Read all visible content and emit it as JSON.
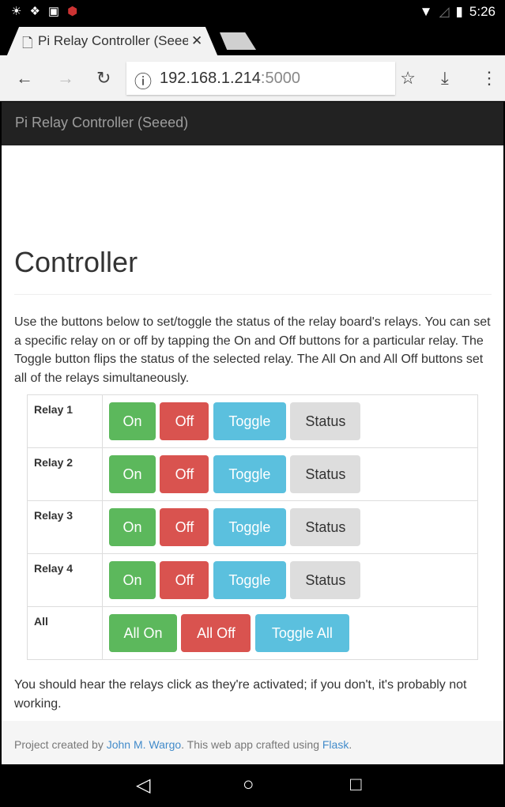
{
  "status_bar": {
    "time": "5:26"
  },
  "browser": {
    "tab_title": "Pi Relay Controller (Seeed)",
    "url_host": "192.168.1.214",
    "url_port": ":5000"
  },
  "navbar": {
    "brand": "Pi Relay Controller (Seeed)"
  },
  "main": {
    "heading": "Controller",
    "description": "Use the buttons below to set/toggle the status of the relay board's relays. You can set a specific relay on or off by tapping the On and Off buttons for a particular relay. The Toggle button flips the status of the selected relay. The All On and All Off buttons set all of the relays simultaneously.",
    "relays": [
      {
        "label": "Relay 1"
      },
      {
        "label": "Relay 2"
      },
      {
        "label": "Relay 3"
      },
      {
        "label": "Relay 4"
      }
    ],
    "buttons": {
      "on": "On",
      "off": "Off",
      "toggle": "Toggle",
      "status": "Status"
    },
    "all": {
      "label": "All",
      "on": "All On",
      "off": "All Off",
      "toggle": "Toggle All"
    },
    "note": "You should hear the relays click as they're activated; if you don't, it's probably not working."
  },
  "footer": {
    "prefix": "Project created by ",
    "author": "John M. Wargo",
    "middle": ". This web app crafted using ",
    "framework": "Flask",
    "suffix": "."
  },
  "colors": {
    "on": "#5cb85c",
    "off": "#d9534f",
    "toggle": "#5bc0de",
    "status": "#dddddd",
    "navbar": "#222222",
    "link": "#428bca"
  }
}
